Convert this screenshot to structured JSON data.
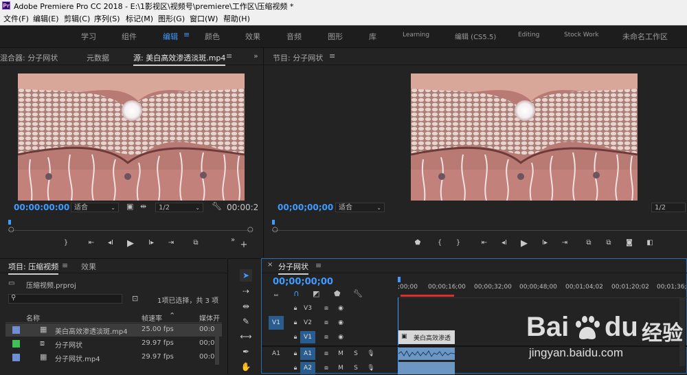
{
  "titlebar": {
    "icon": "Pr",
    "title": "Adobe Premiere Pro CC 2018 - E:\\1影视区\\视频号\\premiere\\工作区\\压缩视频 *"
  },
  "menu": [
    "文件(F)",
    "编辑(E)",
    "剪辑(C)",
    "序列(S)",
    "标记(M)",
    "图形(G)",
    "窗口(W)",
    "帮助(H)"
  ],
  "workspaces": [
    "学习",
    "组件",
    "编辑",
    "颜色",
    "效果",
    "音频",
    "图形",
    "库",
    "Learning",
    "编辑 (CS5.5)",
    "Editing",
    "Stock Work",
    "未命名工作区"
  ],
  "active_workspace": "编辑",
  "source_panel": {
    "tabs": [
      "混合器: 分子网状",
      "元数据",
      "源: 美白高效渗透淡斑.mp4"
    ],
    "timecode": "00:00:00:00",
    "zoom": "适合",
    "resolution": "1/2",
    "duration": "00:00:2"
  },
  "program_panel": {
    "tab": "节目: 分子网状",
    "timecode": "00;00;00;00",
    "zoom": "适合",
    "resolution": "1/2"
  },
  "project_panel": {
    "tabs": [
      "项目: 压缩视频",
      "效果"
    ],
    "project_file": "压缩视频.prproj",
    "selection_info": "1项已选择，共 3 项",
    "columns": [
      "名称",
      "帧速率",
      "媒体开"
    ],
    "items": [
      {
        "name": "美白高效渗透淡斑.mp4",
        "fps": "25.00 fps",
        "media": "00:0",
        "color": "#6f8fd2",
        "selected": true
      },
      {
        "name": "分子网状",
        "fps": "29.97 fps",
        "media": "00;0",
        "color": "#3fbf5a",
        "selected": false
      },
      {
        "name": "分子网状.mp4",
        "fps": "29.97 fps",
        "media": "00:0",
        "color": "#6f8fd2",
        "selected": false
      }
    ]
  },
  "timeline": {
    "tab": "分子网状",
    "timecode": "00;00;00;00",
    "ruler": [
      ";00;00",
      "00;00;16;00",
      "00;00;32;00",
      "00;00;48;00",
      "00;01;04;02",
      "00;01;20;02",
      "00;01;36;0"
    ],
    "tracks": {
      "v_source": "V1",
      "a_source": "A1",
      "video": [
        "V3",
        "V2",
        "V1"
      ],
      "audio": [
        "A1",
        "A2"
      ],
      "m": "M",
      "s": "S"
    },
    "clip_label": "美白高效渗透"
  },
  "watermark": {
    "brand": "Bai",
    "brand2": "du",
    "cn": "经验",
    "url": "jingyan.baidu.com"
  },
  "colors": {
    "accent": "#3f9bff",
    "blue_track": "#2a5d8f",
    "red_bar": "#e0302a"
  }
}
